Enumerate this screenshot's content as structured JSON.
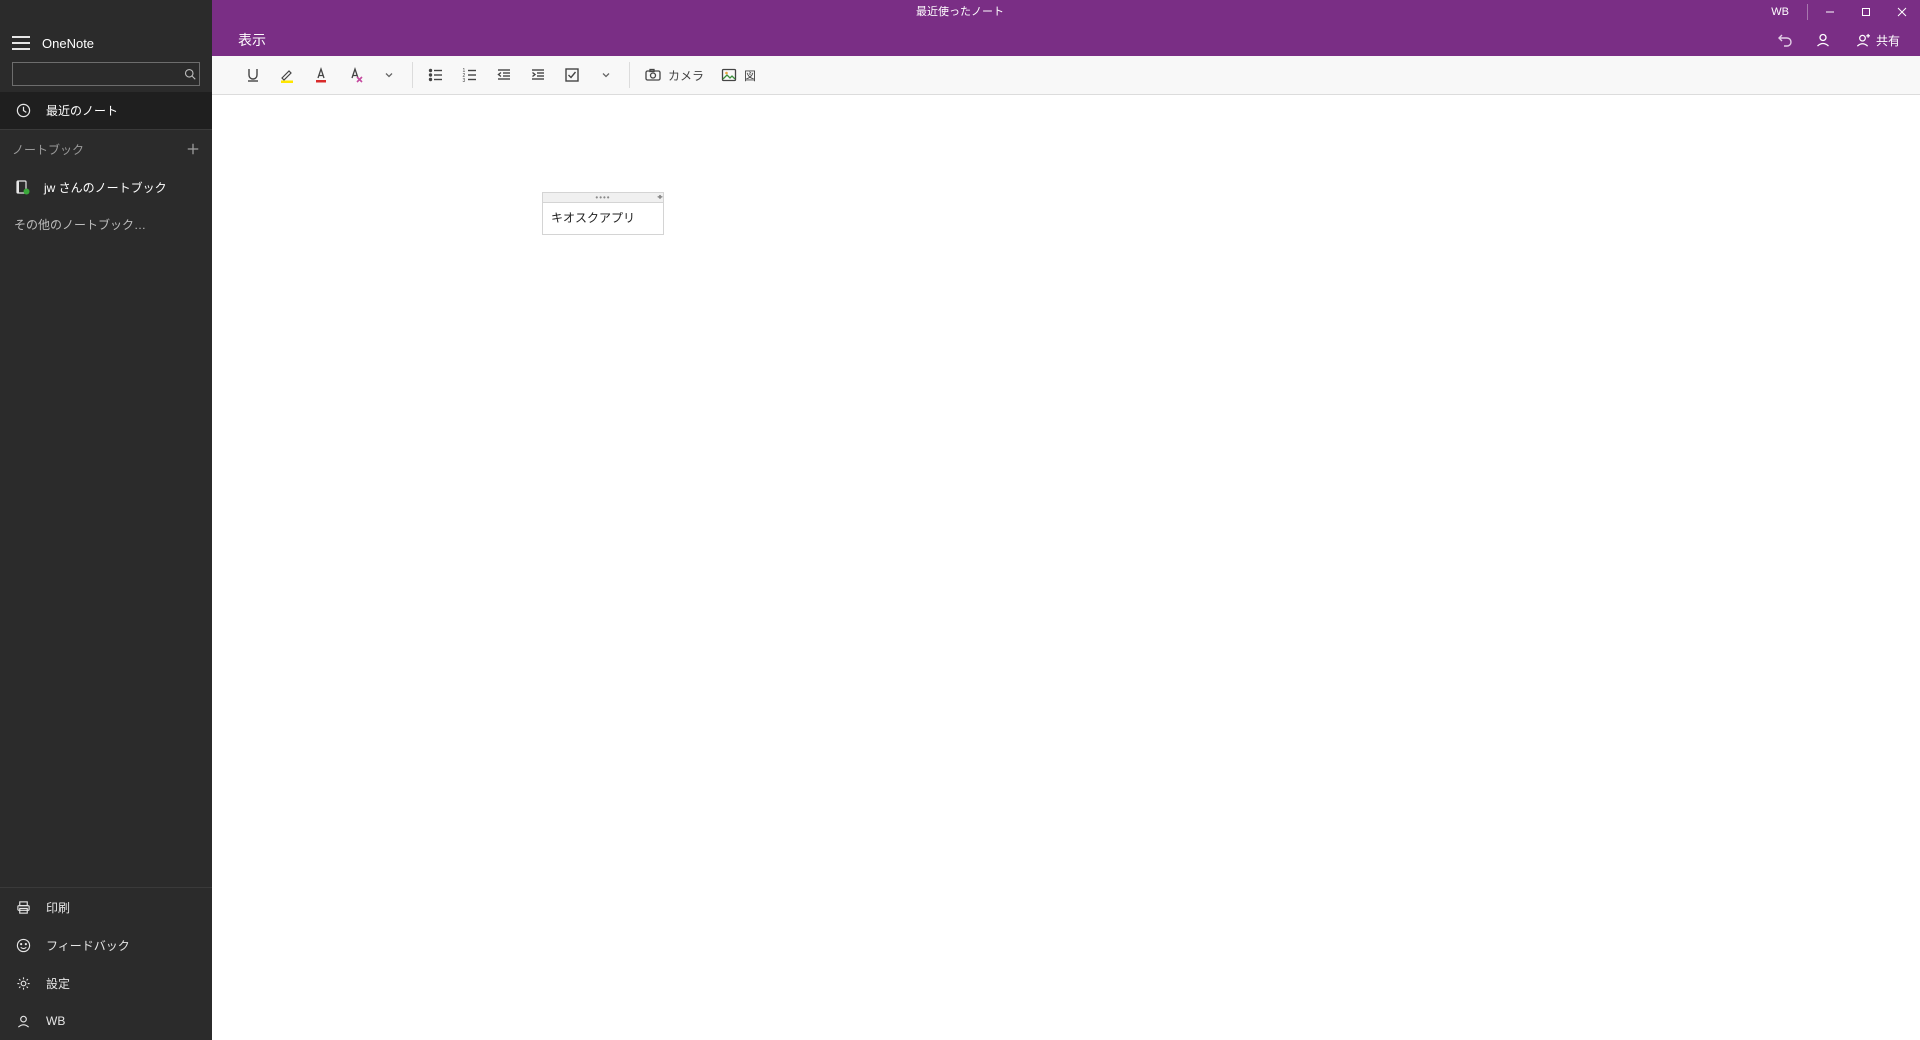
{
  "app": {
    "title": "OneNote"
  },
  "titlebar": {
    "center_text": "最近使ったノート",
    "user_initials": "WB"
  },
  "ribbon": {
    "tab_view": "表示",
    "share_label": "共有"
  },
  "sidebar": {
    "search_placeholder": "",
    "recent_label": "最近のノート",
    "section_header": "ノートブック",
    "notebook0_label": "jw さんのノートブック",
    "other_notebooks_label": "その他のノートブック…",
    "footer_print": "印刷",
    "footer_feedback": "フィードバック",
    "footer_settings": "設定",
    "footer_account": "WB"
  },
  "toolbar": {
    "camera_label": "カメラ",
    "picture_label": "図"
  },
  "note": {
    "text": "キオスクアプリ"
  }
}
